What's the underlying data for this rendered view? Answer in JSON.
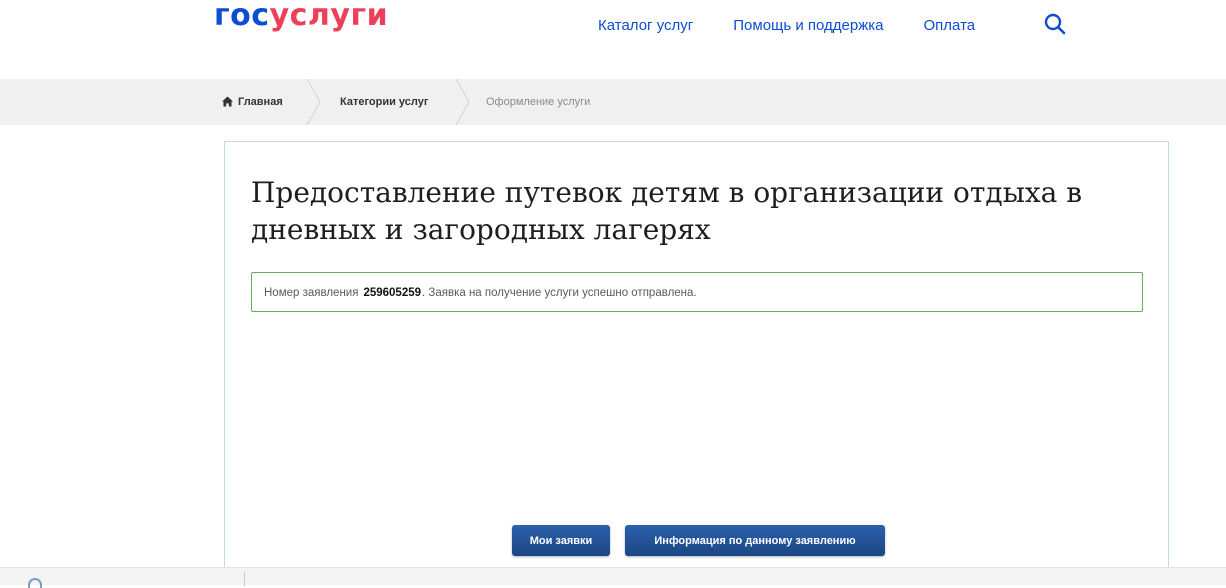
{
  "header": {
    "logo_part1": "гос",
    "logo_part2": "услуги",
    "nav": [
      {
        "label": "Каталог услуг"
      },
      {
        "label": "Помощь и поддержка"
      },
      {
        "label": "Оплата"
      }
    ],
    "search_icon": "search-icon"
  },
  "breadcrumbs": {
    "home": "Главная",
    "category": "Категории услуг",
    "current": "Оформление услуги"
  },
  "main": {
    "title": "Предоставление путевок детям в организации отдыха в дневных и загородных лагерях",
    "status": {
      "prefix": "Номер заявления",
      "number": "259605259",
      "message": ". Заявка на получение услуги успешно отправлена."
    },
    "buttons": {
      "my_requests": "Мои заявки",
      "request_info": "Информация по данному заявлению"
    }
  },
  "colors": {
    "brand_blue": "#0d4cd3",
    "brand_red": "#ee3f58",
    "button_blue": "#1f4e8f",
    "success_border": "#62b05a"
  }
}
